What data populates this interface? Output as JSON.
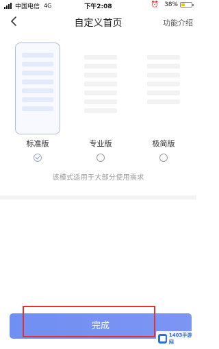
{
  "status_bar": {
    "carrier": "中国电信",
    "network": "4G",
    "time": "下午2:08",
    "alarm_icon": "alarm-clock-icon",
    "battery_percent_text": "38%",
    "battery_level": 0.38,
    "battery_color": "#f2c200"
  },
  "nav": {
    "back_icon": "chevron-left-icon",
    "title": "自定义首页",
    "help_link": "功能介绍"
  },
  "options": [
    {
      "label": "标准版",
      "selected": true
    },
    {
      "label": "专业版",
      "selected": false
    },
    {
      "label": "极简版",
      "selected": false
    }
  ],
  "description": "该模式适用于大部分使用需求",
  "done_button": {
    "label": "完成",
    "color": "#7390f2"
  },
  "highlight_color": "#e0322e",
  "watermark": {
    "text": "1403手游网"
  }
}
